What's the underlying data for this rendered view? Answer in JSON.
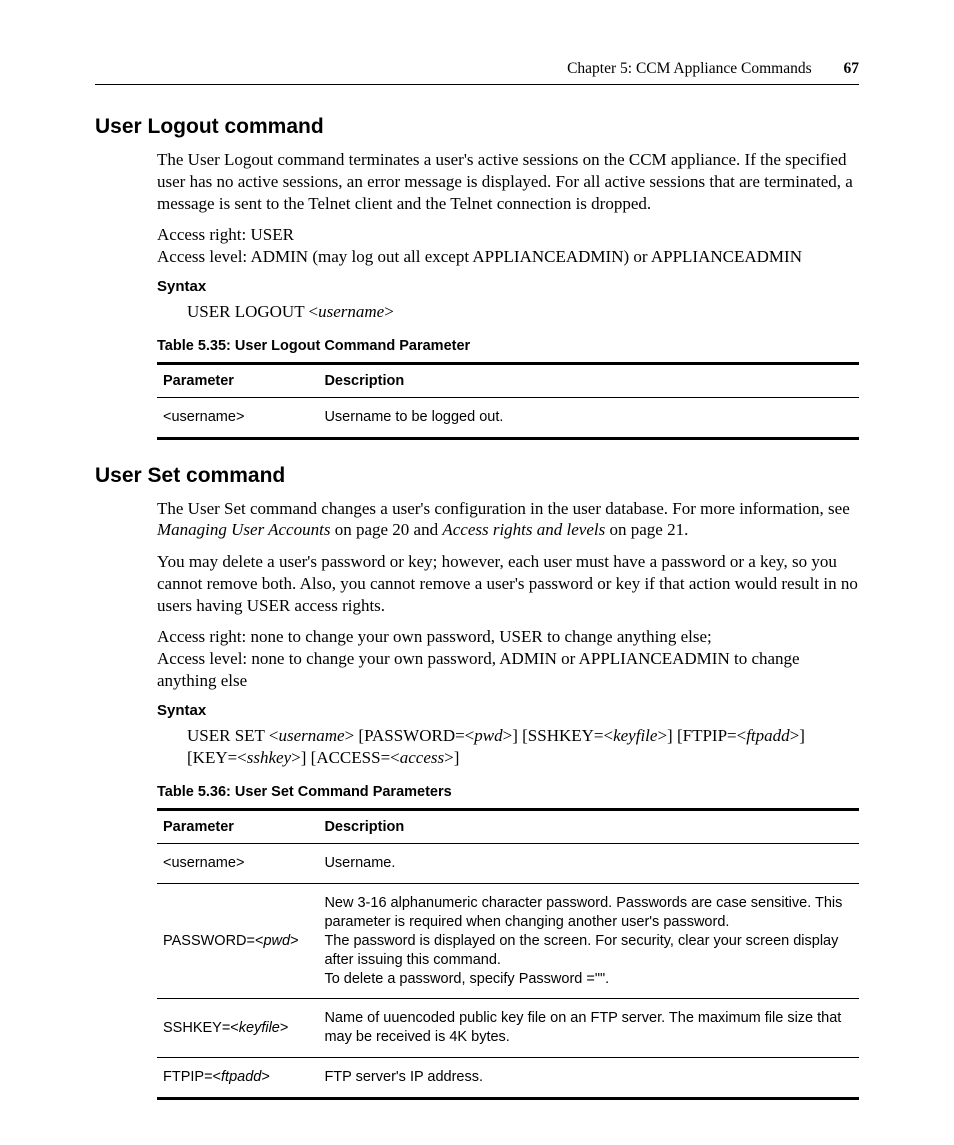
{
  "header": {
    "chapter": "Chapter 5: CCM Appliance Commands",
    "page": "67"
  },
  "sec1": {
    "title": "User Logout command",
    "p1": "The User Logout command terminates a user's active sessions on the CCM appliance. If the specified user has no active sessions, an error message is displayed. For all active sessions that are terminated, a message is sent to the Telnet client and the Telnet connection is dropped.",
    "access_right": "Access right: USER",
    "access_level": "Access level: ADMIN (may log out all except APPLIANCEADMIN) or APPLIANCEADMIN",
    "syntax_label": "Syntax",
    "syntax_a": "USER LOGOUT <",
    "syntax_b": "username",
    "syntax_c": ">",
    "table_caption": "Table 5.35: User Logout Command Parameter",
    "th_param": "Parameter",
    "th_desc": "Description",
    "row1_param": "<username>",
    "row1_desc": "Username to be logged out."
  },
  "sec2": {
    "title": "User Set command",
    "p1a": "The User Set command changes a user's configuration in the user database. For more information, see ",
    "p1b": "Managing User Accounts",
    "p1c": " on page 20 and ",
    "p1d": "Access rights and levels",
    "p1e": " on page 21.",
    "p2": "You may delete a user's password or key; however, each user must have a password or a key, so you cannot remove both. Also, you cannot remove a user's password or key if that action would result in no users having USER access rights.",
    "access_right": "Access right: none to change your own password, USER to change anything else;",
    "access_level": "Access level: none to change your own password, ADMIN or APPLIANCEADMIN to change anything else",
    "syntax_label": "Syntax",
    "s1": "USER SET <",
    "s2": "username",
    "s3": "> [PASSWORD=<",
    "s4": "pwd",
    "s5": ">] [SSHKEY=<",
    "s6": "keyfile",
    "s7": ">] [FTPIP=<",
    "s8": "ftpadd",
    "s9": ">] [KEY=<",
    "s10": "sshkey",
    "s11": ">] [ACCESS=<",
    "s12": "access",
    "s13": ">]",
    "table_caption": "Table 5.36: User Set Command Parameters",
    "th_param": "Parameter",
    "th_desc": "Description",
    "r1_param": "<username>",
    "r1_desc": "Username.",
    "r2_p1": "PASSWORD=<",
    "r2_p2": "pwd",
    "r2_p3": ">",
    "r2_desc": "New 3-16 alphanumeric character password. Passwords are case sensitive. This parameter is required when changing another user's password.\nThe password is displayed on the screen. For security, clear your screen display after issuing this command.\nTo delete a password, specify Password =\"\".",
    "r3_p1": "SSHKEY=<",
    "r3_p2": "keyfile",
    "r3_p3": ">",
    "r3_desc": "Name of uuencoded public key file on an FTP server. The maximum file size that may be received is 4K bytes.",
    "r4_p1": "FTPIP=<",
    "r4_p2": "ftpadd",
    "r4_p3": ">",
    "r4_desc": "FTP server's IP address."
  }
}
